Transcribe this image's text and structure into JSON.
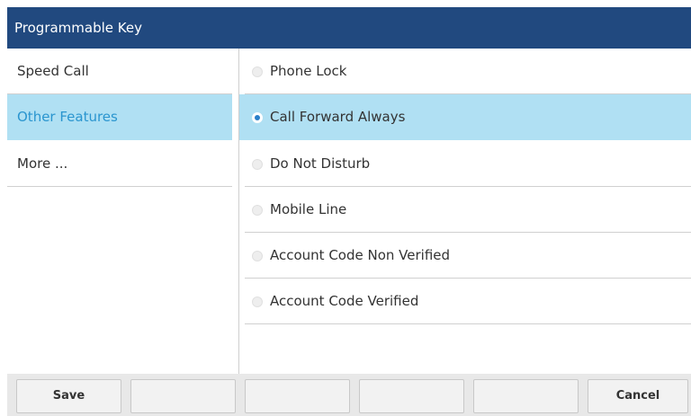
{
  "window": {
    "title": "Programmable Key"
  },
  "categories": [
    {
      "label": "Speed Call",
      "selected": false
    },
    {
      "label": "Other Features",
      "selected": true
    },
    {
      "label": "More ...",
      "selected": false
    }
  ],
  "options": [
    {
      "label": "Phone Lock",
      "selected": false
    },
    {
      "label": "Call Forward Always",
      "selected": true
    },
    {
      "label": "Do Not Disturb",
      "selected": false
    },
    {
      "label": "Mobile Line",
      "selected": false
    },
    {
      "label": "Account Code Non Verified",
      "selected": false
    },
    {
      "label": "Account Code Verified",
      "selected": false
    }
  ],
  "softkeys": [
    {
      "label": "Save"
    },
    {
      "label": ""
    },
    {
      "label": ""
    },
    {
      "label": ""
    },
    {
      "label": ""
    },
    {
      "label": "Cancel"
    }
  ],
  "colors": {
    "title_bar": "#21497f",
    "selection_background": "#b0e0f3",
    "selection_text": "#2a95cf",
    "radio_selected": "#2a7fc8"
  }
}
